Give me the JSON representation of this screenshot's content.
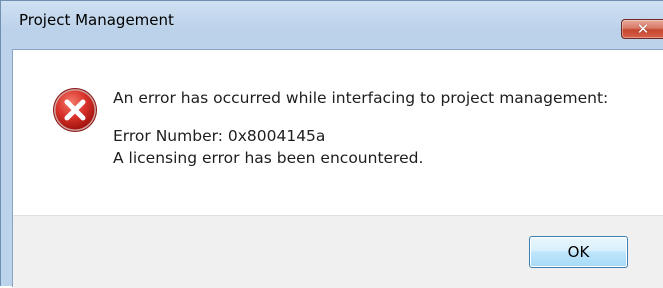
{
  "window": {
    "title": "Project Management",
    "close_icon": "close-icon"
  },
  "dialog": {
    "icon": "error-icon",
    "message_line_1": "An error has occurred while interfacing to project management:",
    "message_line_2": "Error Number: 0x8004145a",
    "message_line_3": "A licensing error has been encountered."
  },
  "buttons": {
    "ok_label": "OK"
  },
  "colors": {
    "close_button": "#c5462e",
    "error_icon": "#c8211b",
    "ok_button_border": "#3c7fb1",
    "footer_bg": "#f0f0f0"
  }
}
